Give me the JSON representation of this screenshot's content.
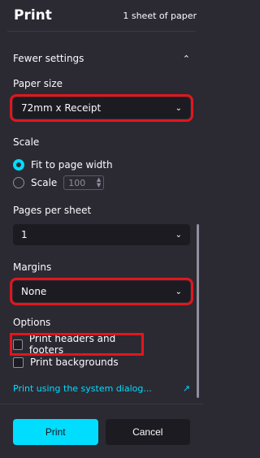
{
  "header": {
    "title": "Print",
    "sheet_count": "1 sheet of paper"
  },
  "settings_toggle": {
    "label": "Fewer settings"
  },
  "paper_size": {
    "label": "Paper size",
    "value": "72mm x Receipt"
  },
  "scale": {
    "label": "Scale",
    "fit_label": "Fit to page width",
    "scale_label": "Scale",
    "scale_value": "100",
    "selected": "fit"
  },
  "pages_per_sheet": {
    "label": "Pages per sheet",
    "value": "1"
  },
  "margins": {
    "label": "Margins",
    "value": "None"
  },
  "options": {
    "label": "Options",
    "headers_footers": "Print headers and footers",
    "backgrounds": "Print backgrounds"
  },
  "system_dialog": {
    "label": "Print using the system dialog..."
  },
  "footer": {
    "print_label": "Print",
    "cancel_label": "Cancel"
  },
  "colors": {
    "accent": "#00ddff",
    "highlight": "#e2161c",
    "background": "#2b2a33"
  }
}
